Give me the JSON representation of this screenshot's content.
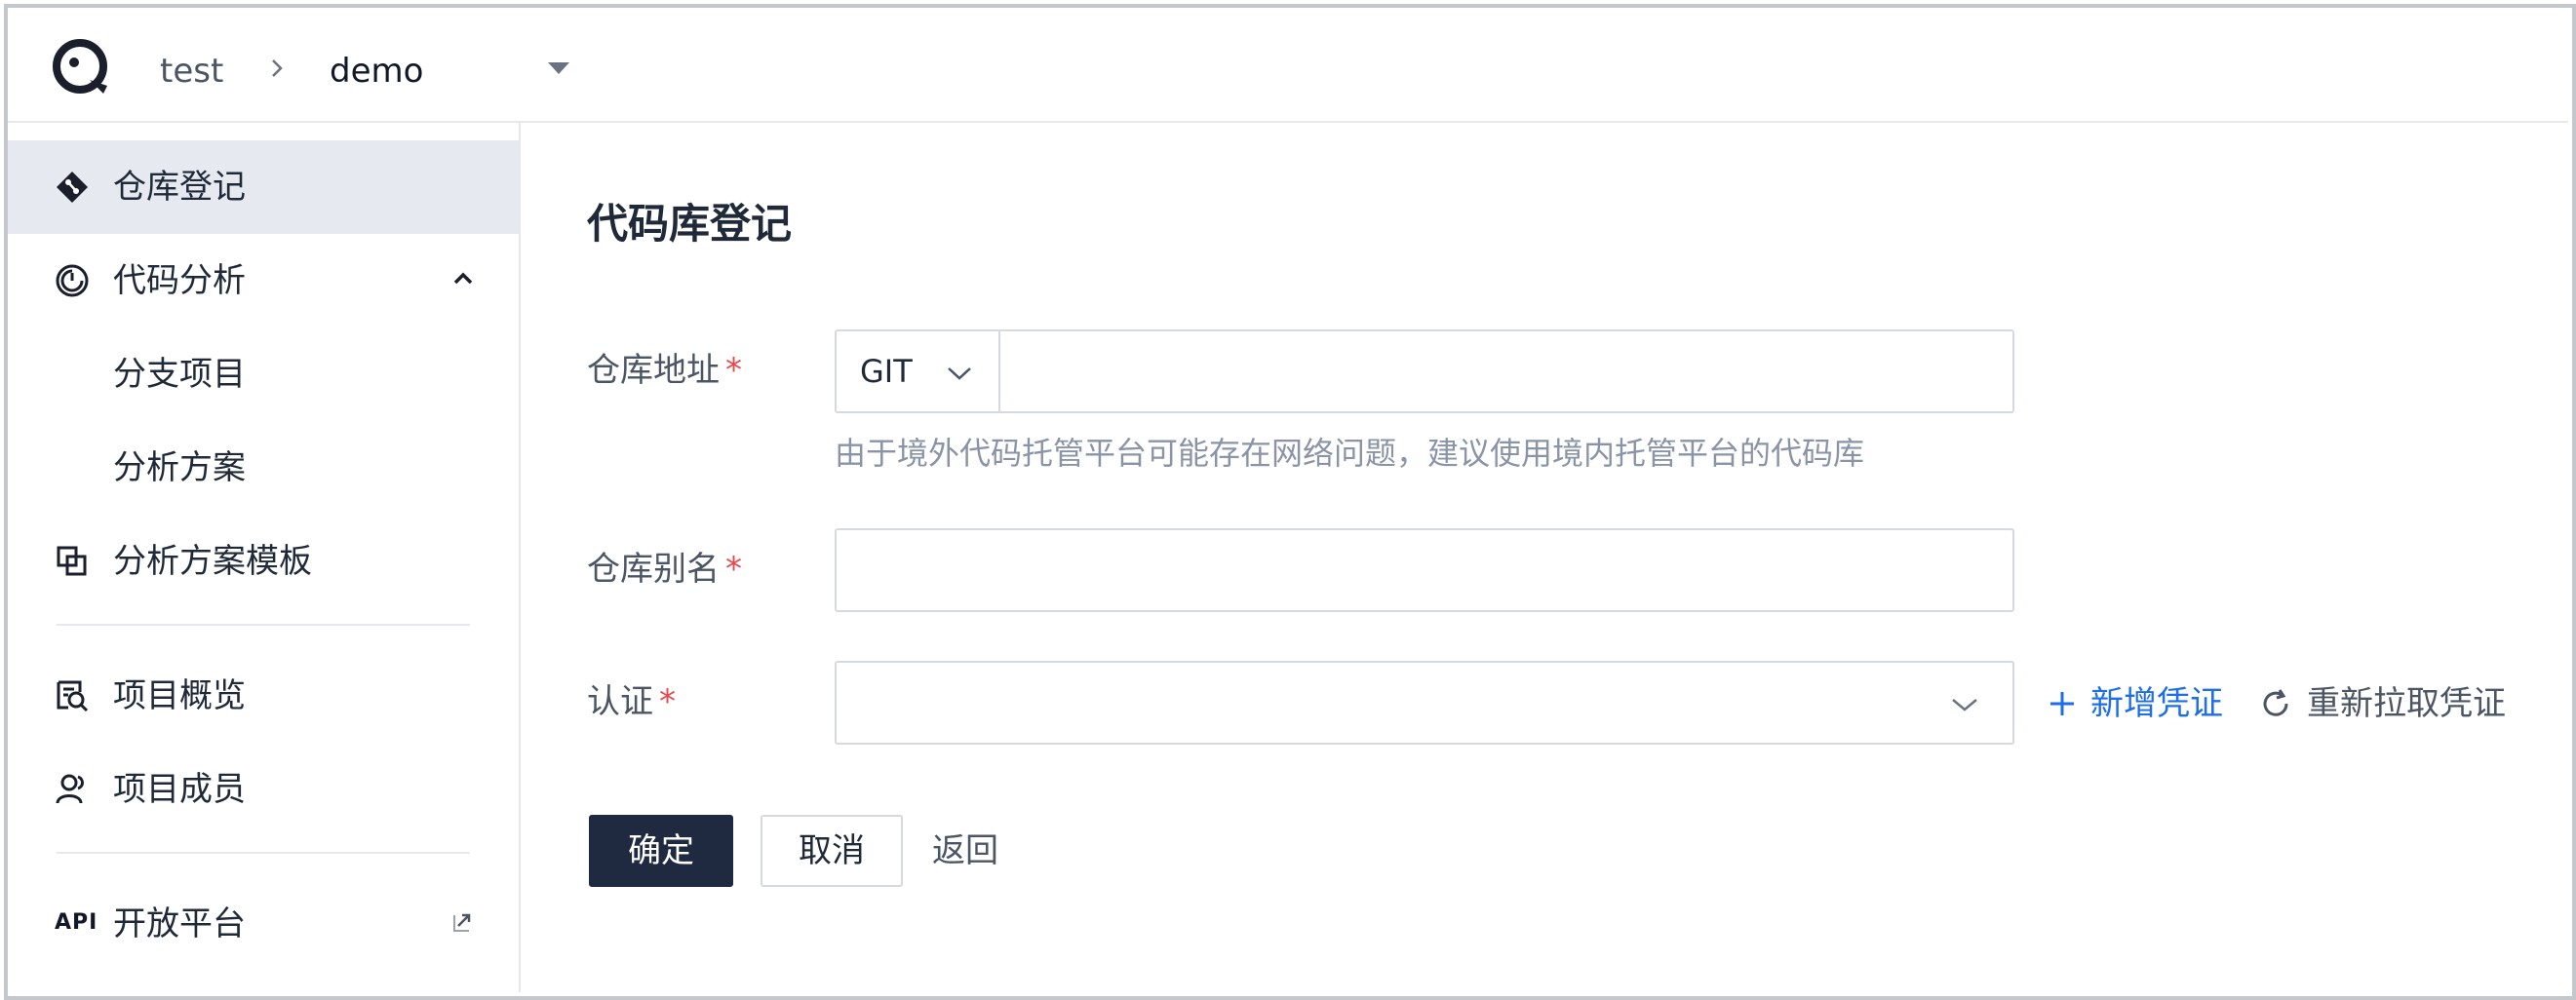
{
  "header": {
    "breadcrumb_root": "test",
    "breadcrumb_current": "demo"
  },
  "sidebar": {
    "items": [
      {
        "label": "仓库登记",
        "icon": "git-diamond-icon"
      },
      {
        "label": "代码分析",
        "icon": "analysis-dial-icon"
      },
      {
        "label": "分支项目"
      },
      {
        "label": "分析方案"
      },
      {
        "label": "分析方案模板",
        "icon": "template-copy-icon"
      },
      {
        "label": "项目概览",
        "icon": "overview-search-icon"
      },
      {
        "label": "项目成员",
        "icon": "member-user-icon"
      },
      {
        "label": "开放平台",
        "icon_text": "API"
      }
    ]
  },
  "form": {
    "title": "代码库登记",
    "repo_url_label": "仓库地址",
    "required_mark": "*",
    "protocol_value": "GIT",
    "repo_url_value": "",
    "hint": "由于境外代码托管平台可能存在网络问题，建议使用境内托管平台的代码库",
    "alias_label": "仓库别名",
    "alias_value": "",
    "auth_label": "认证",
    "auth_value": "",
    "add_credential": "新增凭证",
    "refresh_credential": "重新拉取凭证",
    "confirm": "确定",
    "cancel": "取消",
    "back": "返回"
  },
  "colors": {
    "primary_button": "#1f2a40",
    "link_blue": "#1d6ee8",
    "required_red": "#e5484d",
    "active_nav_bg": "#e6e9f0"
  }
}
